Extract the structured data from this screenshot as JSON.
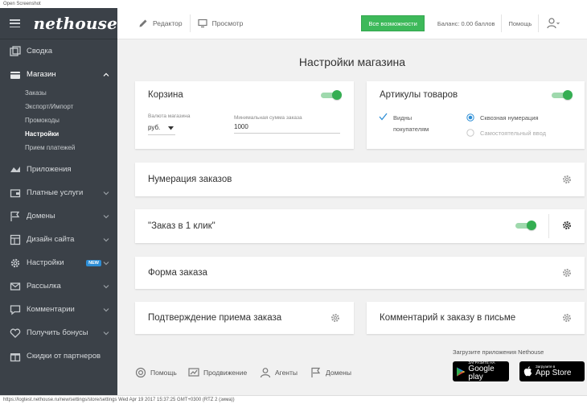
{
  "window": {
    "title": "Open Screenshot"
  },
  "brand": {
    "logo": "nethouse"
  },
  "sidebar": {
    "items": [
      {
        "label": "Сводка",
        "icon": "dashboard-icon"
      },
      {
        "label": "Магазин",
        "icon": "cart-icon"
      },
      {
        "label": "Приложения",
        "icon": "apps-icon"
      },
      {
        "label": "Платные услуги",
        "icon": "wallet-icon"
      },
      {
        "label": "Домены",
        "icon": "flag-icon"
      },
      {
        "label": "Дизайн сайта",
        "icon": "layout-icon"
      },
      {
        "label": "Настройки",
        "icon": "gear-icon",
        "badge": "NEW"
      },
      {
        "label": "Рассылка",
        "icon": "mail-icon"
      },
      {
        "label": "Комментарии",
        "icon": "comment-icon"
      },
      {
        "label": "Получить бонусы",
        "icon": "heart-icon"
      },
      {
        "label": "Скидки от партнеров",
        "icon": "gift-icon"
      }
    ],
    "shop_subitems": [
      "Заказы",
      "Экспорт/Импорт",
      "Промокоды",
      "Настройки",
      "Прием платежей"
    ]
  },
  "topbar": {
    "editor": "Редактор",
    "preview": "Просмотр",
    "all_features": "Все возможности",
    "balance": "Баланс: 0.00 баллов",
    "help": "Помощь"
  },
  "page": {
    "title": "Настройки магазина"
  },
  "cart_card": {
    "title": "Корзина",
    "currency_label": "Валюта магазина",
    "currency_value": "руб.",
    "min_label": "Минимальная сумма заказа",
    "min_value": "1000"
  },
  "articles_card": {
    "title": "Артикулы товаров",
    "visible_line1": "Видны",
    "visible_line2": "покупателям",
    "option1": "Сквозная нумерация",
    "option2": "Самостоятельный ввод"
  },
  "numbering_card": {
    "title": "Нумерация заказов"
  },
  "oneclick_card": {
    "title": "\"Заказ в 1 клик\""
  },
  "form_card": {
    "title": "Форма заказа"
  },
  "confirm_card": {
    "title": "Подтверждение приема заказа"
  },
  "comment_card": {
    "title": "Комментарий к заказу в письме"
  },
  "footer": {
    "help": "Помощь",
    "promotion": "Продвижение",
    "agents": "Агенты",
    "domains": "Домены",
    "apps_caption": "Загрузите приложения Nethouse",
    "google_small": "ЗАГРУЗИТЕ НА",
    "google_big": "Google play",
    "apple_small": "Загрузите в",
    "apple_big": "App Store"
  },
  "statusbar": {
    "text": "https://logtest.nethouse.ru/new/settings/store/settings Wed Apr 19 2017 15:37:25 GMT+0300 (RTZ 2 (зима))"
  },
  "colors": {
    "sidebar": "#3b4148",
    "accent_green": "#3db95a",
    "radio_blue": "#2d8ed6"
  }
}
